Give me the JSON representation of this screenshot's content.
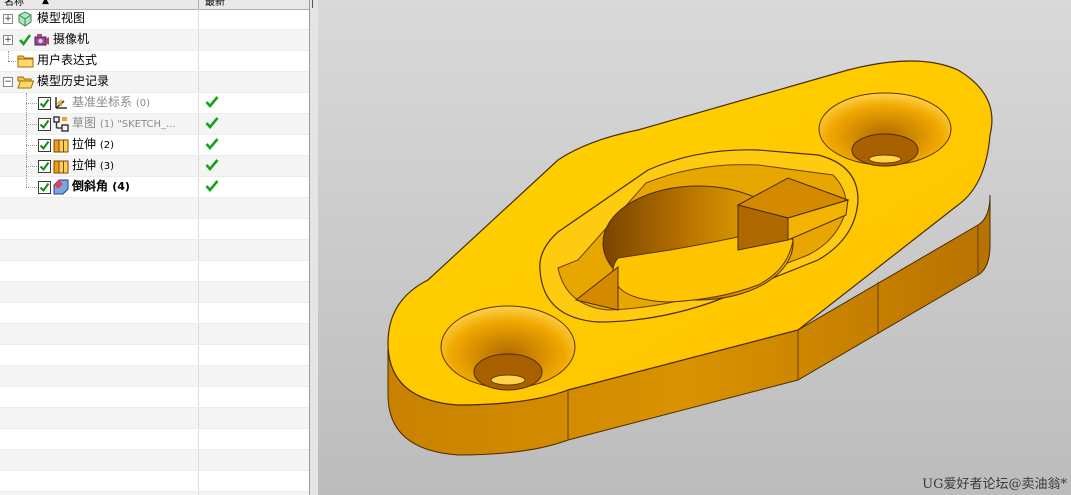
{
  "navigator": {
    "columns": {
      "name": "名称",
      "sort_indicator": "▲",
      "latest": "最新"
    },
    "rows": [
      {
        "label": "模型视图",
        "icon": "model-views-icon",
        "expand": "+"
      },
      {
        "label": "摄像机",
        "icon": "camera-icon",
        "expand": "+"
      },
      {
        "label": "用户表达式",
        "icon": "folder-icon"
      },
      {
        "label": "模型历史记录",
        "icon": "open-folder-icon",
        "expand": "−"
      },
      {
        "label": "基准坐标系",
        "suffix": "(0)",
        "icon": "datum-csys-icon",
        "checked": true,
        "latest": true
      },
      {
        "label": "草图",
        "suffix": "(1) \"SKETCH_...",
        "icon": "sketch-icon",
        "checked": true,
        "latest": true
      },
      {
        "label": "拉伸",
        "suffix": "(2)",
        "icon": "extrude-icon",
        "checked": true,
        "latest": true
      },
      {
        "label": "拉伸",
        "suffix": "(3)",
        "icon": "extrude-icon",
        "checked": true,
        "latest": true
      },
      {
        "label": "倒斜角",
        "suffix": "(4)",
        "icon": "chamfer-icon",
        "checked": true,
        "latest": true
      }
    ]
  },
  "viewport": {
    "part_color": "#FFC400",
    "background": "#CFCFCF",
    "watermark": "UG爱好者论坛@卖油翁*"
  }
}
